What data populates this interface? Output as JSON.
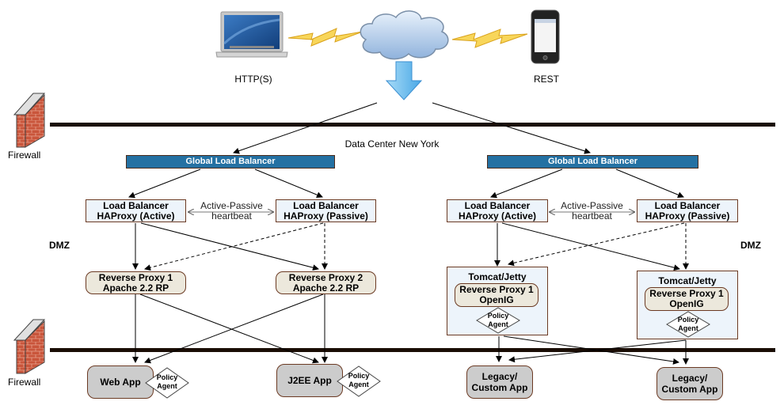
{
  "clients": {
    "laptop_label": "HTTP(S)",
    "phone_label": "REST",
    "laptop_icon": "laptop-icon",
    "phone_icon": "smartphone-icon",
    "cloud_icon": "internet-cloud-icon"
  },
  "firewalls": [
    {
      "label": "Firewall",
      "icon": "brick-firewall-icon"
    },
    {
      "label": "Firewall",
      "icon": "brick-firewall-icon"
    }
  ],
  "datacenter_label": "Data Center New York",
  "zones": {
    "left": "DMZ",
    "right": "DMZ"
  },
  "left_cluster": {
    "global_lb": "Global Load Balancer",
    "lb_active": [
      "Load Balancer",
      "HAProxy (Active)"
    ],
    "lb_passive": [
      "Load Balancer",
      "HAProxy (Passive)"
    ],
    "heartbeat": [
      "Active-Passive",
      "heartbeat"
    ],
    "rp1": [
      "Reverse Proxy 1",
      "Apache 2.2 RP"
    ],
    "rp2": [
      "Reverse Proxy 2",
      "Apache 2.2 RP"
    ],
    "app1": "Web App",
    "app2": "J2EE App",
    "agent": [
      "Policy",
      "Agent"
    ]
  },
  "right_cluster": {
    "global_lb": "Global Load Balancer",
    "lb_active": [
      "Load Balancer",
      "HAProxy (Active)"
    ],
    "lb_passive": [
      "Load Balancer",
      "HAProxy (Passive)"
    ],
    "heartbeat": [
      "Active-Passive",
      "heartbeat"
    ],
    "container_title": "Tomcat/Jetty",
    "rp1": [
      "Reverse Proxy 1",
      "OpenIG"
    ],
    "rp2": [
      "Reverse Proxy 1",
      "OpenIG"
    ],
    "app1": [
      "Legacy/",
      "Custom App"
    ],
    "app2": [
      "Legacy/",
      "Custom App"
    ],
    "agent": [
      "Policy",
      "Agent"
    ]
  },
  "colors": {
    "global_lb_fill": "#2471a3",
    "lb_fill": "#edf4fb",
    "rp_fill": "#ece8dc",
    "app_fill": "#cccccc",
    "border": "#6b3a23",
    "firewall_line": "#1a0d05",
    "arrow_fill": "#7cc4f0"
  }
}
